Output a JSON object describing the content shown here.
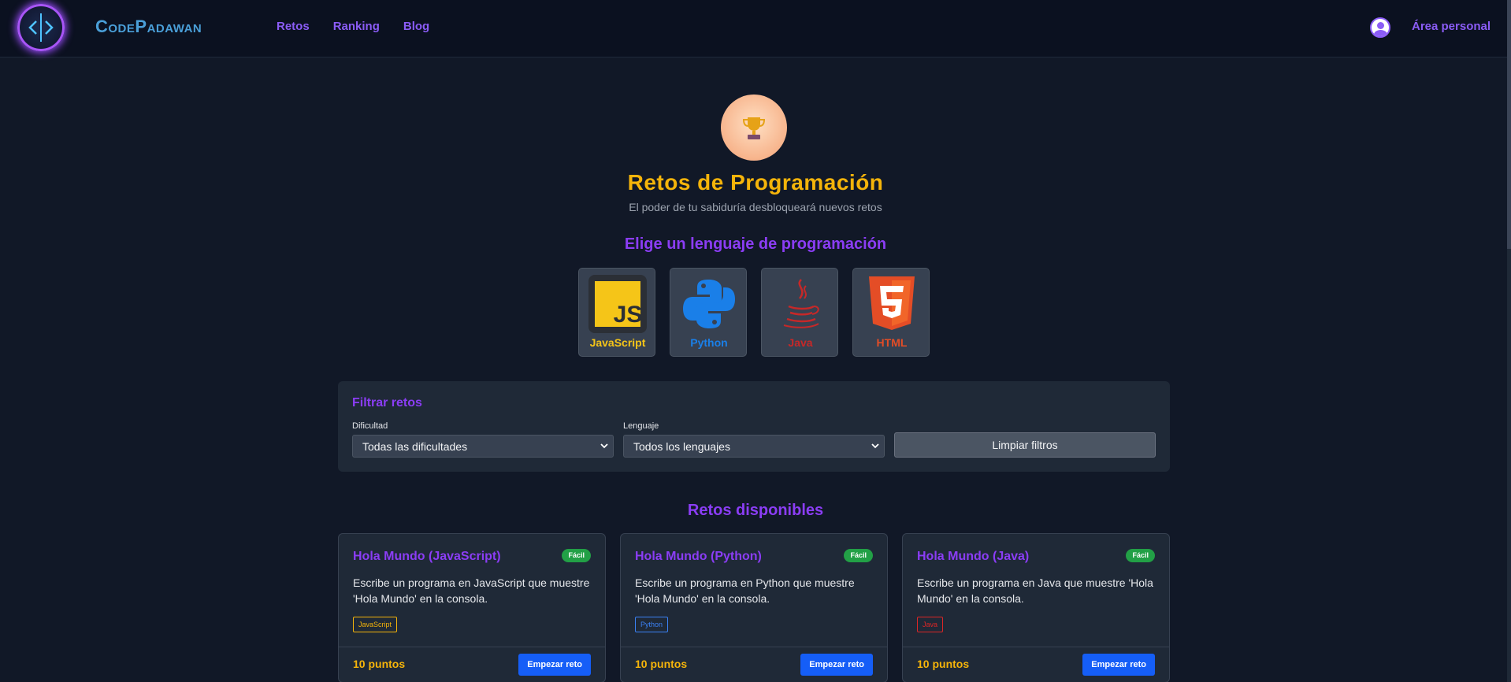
{
  "header": {
    "brand": "CodePadawan",
    "nav": [
      "Retos",
      "Ranking",
      "Blog"
    ],
    "personal_area": "Área personal"
  },
  "hero": {
    "icon": "trophy-icon",
    "title": "Retos de Programación",
    "subtitle": "El poder de tu sabiduría desbloqueará nuevos retos"
  },
  "languages": {
    "heading": "Elige un lenguaje de programación",
    "items": [
      {
        "label": "JavaScript",
        "icon": "javascript-icon",
        "color": "#f5c518"
      },
      {
        "label": "Python",
        "icon": "python-icon",
        "color": "#1a7fe8"
      },
      {
        "label": "Java",
        "icon": "java-icon",
        "color": "#c62828"
      },
      {
        "label": "HTML",
        "icon": "html5-icon",
        "color": "#e44d26"
      }
    ]
  },
  "filters": {
    "title": "Filtrar retos",
    "difficulty_label": "Dificultad",
    "difficulty_value": "Todas las dificultades",
    "language_label": "Lenguaje",
    "language_value": "Todos los lenguajes",
    "clear_button": "Limpiar filtros"
  },
  "challenges": {
    "heading": "Retos disponibles",
    "items": [
      {
        "title": "Hola Mundo (JavaScript)",
        "difficulty": "Fácil",
        "description": "Escribe un programa en JavaScript que muestre 'Hola Mundo' en la consola.",
        "tag": "JavaScript",
        "tag_color": "#f5b40a",
        "points": "10 puntos",
        "button": "Empezar reto"
      },
      {
        "title": "Hola Mundo (Python)",
        "difficulty": "Fácil",
        "description": "Escribe un programa en Python que muestre 'Hola Mundo' en la consola.",
        "tag": "Python",
        "tag_color": "#3b82f6",
        "points": "10 puntos",
        "button": "Empezar reto"
      },
      {
        "title": "Hola Mundo (Java)",
        "difficulty": "Fácil",
        "description": "Escribe un programa en Java que muestre 'Hola Mundo' en la consola.",
        "tag": "Java",
        "tag_color": "#dc2626",
        "points": "10 puntos",
        "button": "Empezar reto"
      }
    ]
  }
}
